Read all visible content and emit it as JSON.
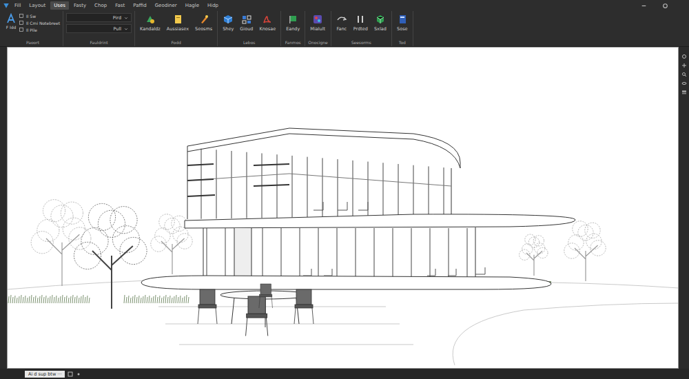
{
  "window": {
    "menu_tabs": [
      {
        "label": "Fill",
        "selected": false
      },
      {
        "label": "Layout",
        "selected": false
      },
      {
        "label": "Uses",
        "selected": true
      },
      {
        "label": "Fasty",
        "selected": false
      },
      {
        "label": "Chop",
        "selected": false
      },
      {
        "label": "Fast",
        "selected": false
      },
      {
        "label": "Paffid",
        "selected": false
      },
      {
        "label": "Geodiner",
        "selected": false
      },
      {
        "label": "Hagle",
        "selected": false
      },
      {
        "label": "Hidp",
        "selected": false
      }
    ]
  },
  "ribbon": {
    "tools": {
      "large_label": "F Idd",
      "small": [
        "Il Sw",
        "Il Cmi Notebreet",
        "Il Pile"
      ],
      "group_label": "Paoort"
    },
    "fields": {
      "values": [
        "Pird",
        "Pull"
      ],
      "group_label": "Fauldrint"
    },
    "groups": [
      {
        "label": "Fodd",
        "buttons": [
          "Kandaldz",
          "Aussiasex",
          "Seosms"
        ]
      },
      {
        "label": "Lebos",
        "buttons": [
          "Shey",
          "Gioud",
          "Knosae"
        ]
      },
      {
        "label": "Fanmos",
        "buttons": [
          "Eandy"
        ]
      },
      {
        "label": "Onocigne",
        "buttons": [
          "Mialult"
        ]
      },
      {
        "label": "Seesorms",
        "buttons": [
          "Fanc",
          "Prdted",
          "Sxlad"
        ]
      },
      {
        "label": "Tod",
        "buttons": [
          "Sose"
        ]
      }
    ]
  },
  "status_bar": {
    "tabs": [
      {
        "label": "Ai d sup btw ···",
        "selected": true
      }
    ]
  }
}
